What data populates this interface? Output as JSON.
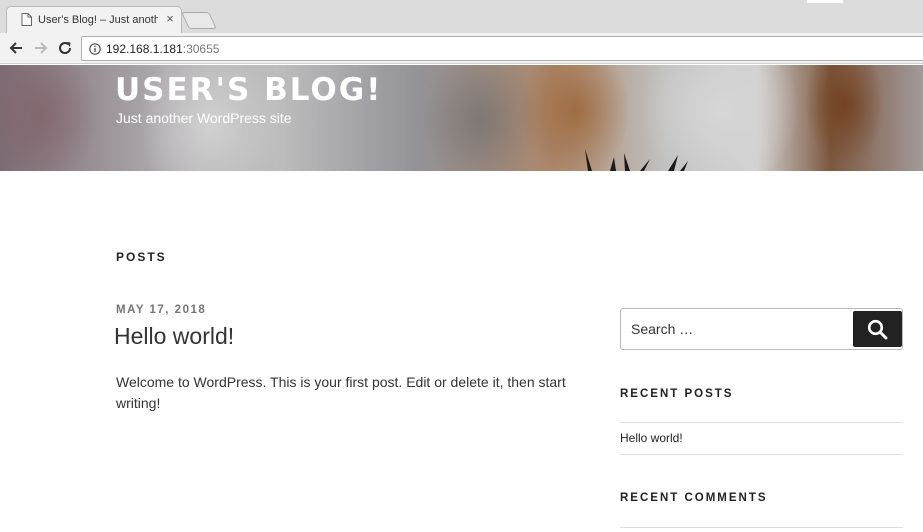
{
  "browser": {
    "tab_title": "User's Blog! – Just another WordPress site",
    "tab_close": "×",
    "url_host": "192.168.1.181",
    "url_port": ":30655"
  },
  "header": {
    "site_title": "USER'S BLOG!",
    "site_description": "Just another WordPress site"
  },
  "main": {
    "section_heading": "POSTS",
    "post": {
      "date": "MAY 17, 2018",
      "title": "Hello world!",
      "body": "Welcome to WordPress. This is your first post. Edit or delete it, then start writing!"
    }
  },
  "sidebar": {
    "search_placeholder": "Search …",
    "recent_posts_title": "RECENT POSTS",
    "recent_posts": [
      "Hello world!"
    ],
    "recent_comments_title": "RECENT COMMENTS"
  },
  "icons": {
    "back": "arrow-left-icon",
    "forward": "arrow-right-icon",
    "reload": "reload-icon",
    "info": "info-icon",
    "page": "page-icon",
    "search": "search-icon"
  },
  "colors": {
    "search_button": "#222222",
    "date": "#767676"
  }
}
